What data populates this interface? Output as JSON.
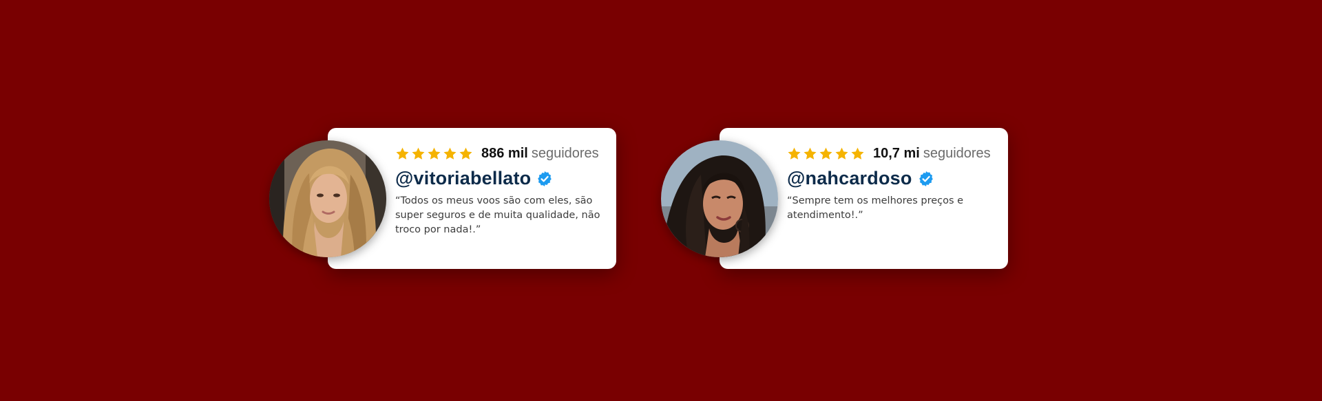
{
  "colors": {
    "background": "#790001",
    "card": "#ffffff",
    "star": "#f5b301",
    "verified": "#1d9bf0",
    "handle": "#0d2b4a"
  },
  "testimonials": [
    {
      "avatar": "blonde-woman-portrait-photo",
      "rating": 5,
      "followers_count": "886 mil",
      "followers_label": "seguidores",
      "handle": "@vitoriabellato",
      "verified_icon": "verified-badge-icon",
      "quote": "“Todos os meus voos são com eles, são super seguros e de muita qualidade, não troco por nada!.”"
    },
    {
      "avatar": "dark-haired-woman-portrait-photo",
      "rating": 5,
      "followers_count": "10,7 mi",
      "followers_label": "seguidores",
      "handle": "@nahcardoso",
      "verified_icon": "verified-badge-icon",
      "quote": "“Sempre tem os melhores preços e atendimento!.”"
    }
  ]
}
